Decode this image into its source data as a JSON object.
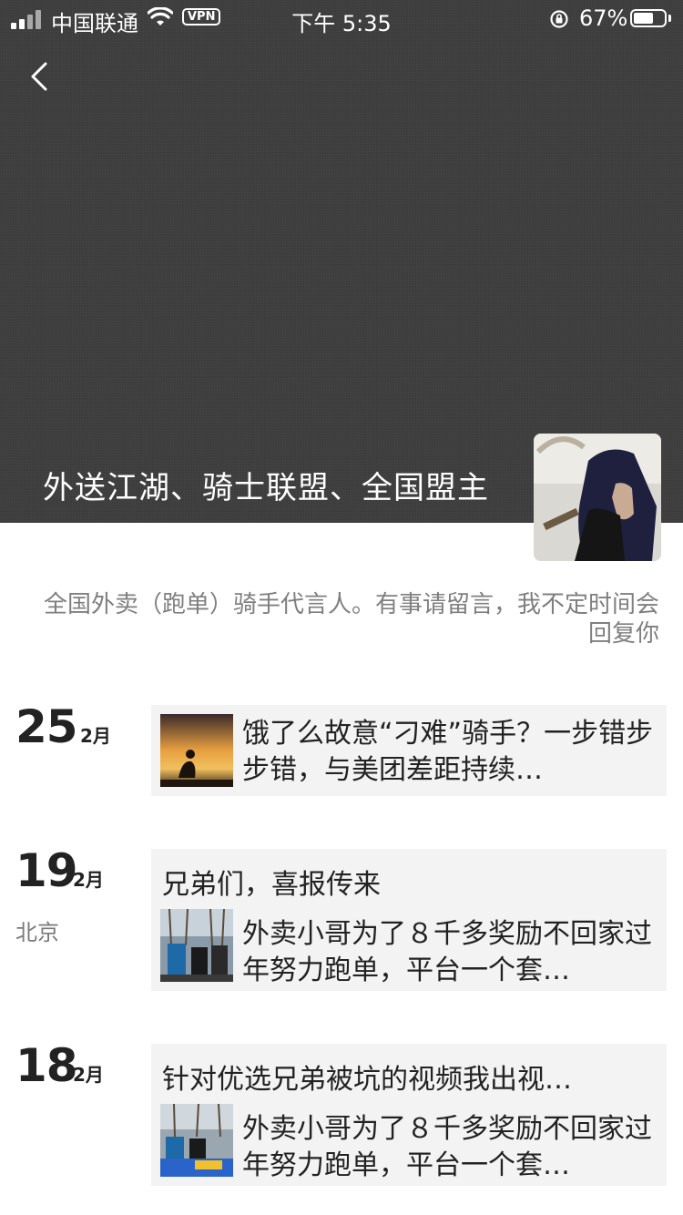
{
  "status": {
    "carrier": "中国联通",
    "vpn": "VPN",
    "time": "下午 5:35",
    "battery_pct": "67%",
    "battery_level": 0.67
  },
  "profile": {
    "name": "外送江湖、骑士联盟、全国盟主",
    "signature": "全国外卖（跑单）骑手代言人。有事请留言，我不定时间会回复你"
  },
  "posts": [
    {
      "day": "25",
      "month": "2月",
      "link_text": "饿了么故意“刁难”骑手？一步错步步错，与美团差距持续…"
    },
    {
      "day": "19",
      "month": "2月",
      "location": "北京",
      "title": "兄弟们，喜报传来",
      "link_text": "外卖小哥为了８千多奖励不回家过年努力跑单，平台一个套…"
    },
    {
      "day": "18",
      "month": "2月",
      "title": "针对优选兄弟被坑的视频我出视…",
      "link_text": "外卖小哥为了８千多奖励不回家过年努力跑单，平台一个套…"
    }
  ]
}
